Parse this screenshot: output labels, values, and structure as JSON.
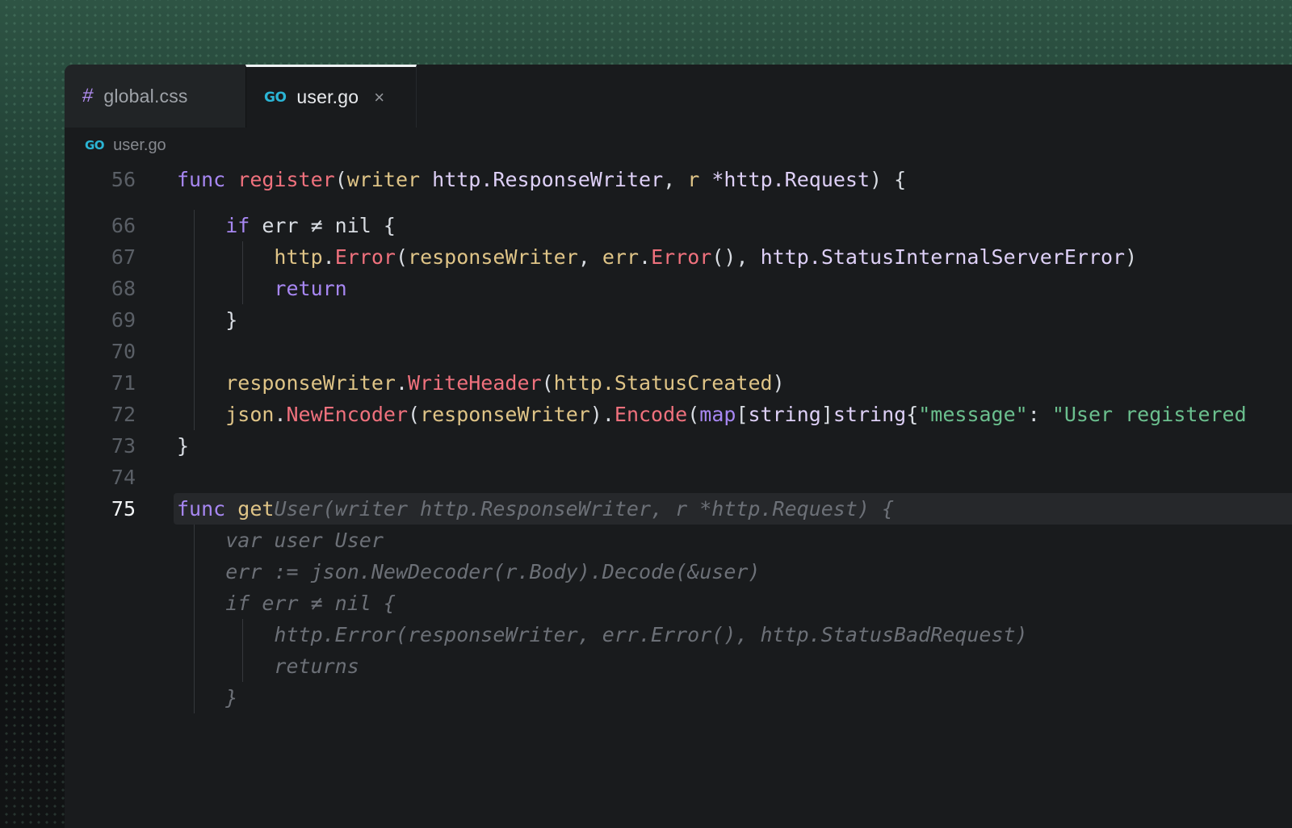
{
  "colors": {
    "backdrop_green": "#2e5444",
    "editor_bg": "#191b1d",
    "inactive_tab_bg": "#212426",
    "active_tab_border": "#eef1f3",
    "keyword": "#a787f2",
    "function": "#ef717d",
    "variable": "#dfc487",
    "type": "#ded0f7",
    "string": "#6bbf8e",
    "default_text": "#d8dce2",
    "ghost_text": "#6c7077",
    "line_number": "#5a5f66",
    "go_brand": "#2bb5d5",
    "css_hash": "#b38ef3"
  },
  "tabs": [
    {
      "icon": "css-hash",
      "icon_glyph": "#",
      "label": "global.css",
      "active": false
    },
    {
      "icon": "go",
      "icon_glyph": "GO",
      "label": "user.go",
      "active": true,
      "close_glyph": "×"
    }
  ],
  "breadcrumb": {
    "icon_glyph": "GO",
    "label": "user.go"
  },
  "code": {
    "language": "go",
    "lines": [
      {
        "num": "56",
        "indent": 0,
        "guides": [],
        "gap_after": 18,
        "segments": [
          {
            "t": "func",
            "c": "kw"
          },
          {
            "t": " ",
            "c": "def"
          },
          {
            "t": "register",
            "c": "fn"
          },
          {
            "t": "(",
            "c": "def"
          },
          {
            "t": "writer",
            "c": "var"
          },
          {
            "t": " ",
            "c": "def"
          },
          {
            "t": "http.ResponseWriter",
            "c": "type"
          },
          {
            "t": ", ",
            "c": "def"
          },
          {
            "t": "r",
            "c": "var"
          },
          {
            "t": " ",
            "c": "def"
          },
          {
            "t": "*http.Request",
            "c": "type"
          },
          {
            "t": ") {",
            "c": "def"
          }
        ]
      },
      {
        "num": "66",
        "indent": 1,
        "guides": [
          1
        ],
        "segments": [
          {
            "t": "if",
            "c": "kw"
          },
          {
            "t": " err ≠ nil {",
            "c": "def"
          }
        ]
      },
      {
        "num": "67",
        "indent": 2,
        "guides": [
          1,
          2
        ],
        "segments": [
          {
            "t": "http",
            "c": "var"
          },
          {
            "t": ".",
            "c": "def"
          },
          {
            "t": "Error",
            "c": "fn"
          },
          {
            "t": "(",
            "c": "def"
          },
          {
            "t": "responseWriter",
            "c": "var"
          },
          {
            "t": ", ",
            "c": "def"
          },
          {
            "t": "err",
            "c": "var"
          },
          {
            "t": ".",
            "c": "def"
          },
          {
            "t": "Error",
            "c": "fn"
          },
          {
            "t": "(), ",
            "c": "def"
          },
          {
            "t": "http.StatusInternalServerError",
            "c": "type"
          },
          {
            "t": ")",
            "c": "def"
          }
        ]
      },
      {
        "num": "68",
        "indent": 2,
        "guides": [
          1,
          2
        ],
        "segments": [
          {
            "t": "return",
            "c": "kw"
          }
        ]
      },
      {
        "num": "69",
        "indent": 1,
        "guides": [
          1
        ],
        "segments": [
          {
            "t": "}",
            "c": "def"
          }
        ]
      },
      {
        "num": "70",
        "indent": 0,
        "guides": [
          1
        ],
        "segments": []
      },
      {
        "num": "71",
        "indent": 1,
        "guides": [
          1
        ],
        "segments": [
          {
            "t": "responseWriter",
            "c": "var"
          },
          {
            "t": ".",
            "c": "def"
          },
          {
            "t": "WriteHeader",
            "c": "fn"
          },
          {
            "t": "(",
            "c": "def"
          },
          {
            "t": "http.StatusCreated",
            "c": "var"
          },
          {
            "t": ")",
            "c": "def"
          }
        ]
      },
      {
        "num": "72",
        "indent": 1,
        "guides": [
          1
        ],
        "segments": [
          {
            "t": "json",
            "c": "var"
          },
          {
            "t": ".",
            "c": "def"
          },
          {
            "t": "NewEncoder",
            "c": "fn"
          },
          {
            "t": "(",
            "c": "def"
          },
          {
            "t": "responseWriter",
            "c": "var"
          },
          {
            "t": ").",
            "c": "def"
          },
          {
            "t": "Encode",
            "c": "fn"
          },
          {
            "t": "(",
            "c": "def"
          },
          {
            "t": "map",
            "c": "kw"
          },
          {
            "t": "[",
            "c": "def"
          },
          {
            "t": "string",
            "c": "type"
          },
          {
            "t": "]",
            "c": "def"
          },
          {
            "t": "string",
            "c": "type"
          },
          {
            "t": "{",
            "c": "def"
          },
          {
            "t": "\"message\"",
            "c": "str"
          },
          {
            "t": ": ",
            "c": "def"
          },
          {
            "t": "\"User registered",
            "c": "str"
          }
        ]
      },
      {
        "num": "73",
        "indent": 0,
        "guides": [],
        "segments": [
          {
            "t": "}",
            "c": "def"
          }
        ]
      },
      {
        "num": "74",
        "indent": 0,
        "guides": [],
        "segments": []
      },
      {
        "num": "75",
        "indent": 0,
        "guides": [],
        "current": true,
        "segments": [
          {
            "t": "func",
            "c": "kw"
          },
          {
            "t": " ",
            "c": "def"
          },
          {
            "t": "get",
            "c": "var"
          },
          {
            "t": "User(writer http.ResponseWriter, r *http.Request) {",
            "c": "ghost"
          }
        ]
      },
      {
        "num": "",
        "indent": 1,
        "guides": [
          1
        ],
        "segments": [
          {
            "t": "var user User",
            "c": "ghost"
          }
        ]
      },
      {
        "num": "",
        "indent": 1,
        "guides": [
          1
        ],
        "segments": [
          {
            "t": "err := json.NewDecoder(r.Body).Decode(&user)",
            "c": "ghost"
          }
        ]
      },
      {
        "num": "",
        "indent": 1,
        "guides": [
          1
        ],
        "segments": [
          {
            "t": "if err ≠ nil {",
            "c": "ghost"
          }
        ]
      },
      {
        "num": "",
        "indent": 2,
        "guides": [
          1,
          2
        ],
        "segments": [
          {
            "t": "http.Error(responseWriter, err.Error(), http.StatusBadRequest)",
            "c": "ghost"
          }
        ]
      },
      {
        "num": "",
        "indent": 2,
        "guides": [
          1,
          2
        ],
        "segments": [
          {
            "t": "returns",
            "c": "ghost"
          }
        ]
      },
      {
        "num": "",
        "indent": 1,
        "guides": [
          1
        ],
        "segments": [
          {
            "t": "}",
            "c": "ghost"
          }
        ]
      }
    ]
  }
}
